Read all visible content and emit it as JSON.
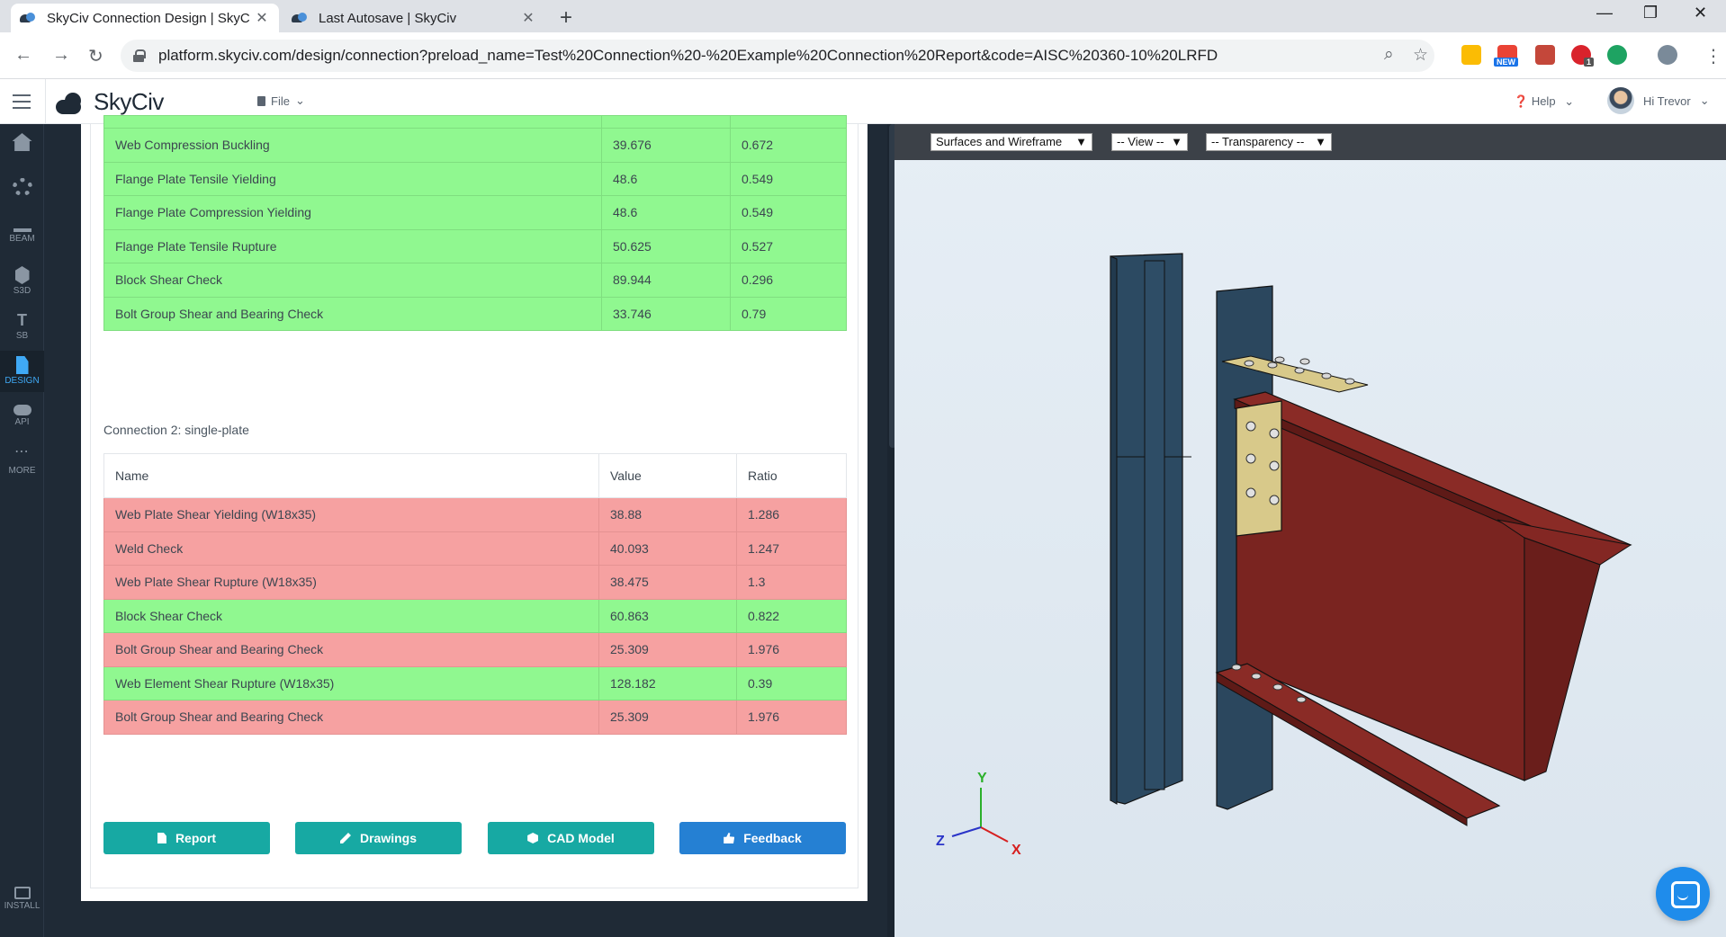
{
  "browser": {
    "tabs": [
      {
        "title": "SkyCiv Connection Design | SkyC",
        "active": true
      },
      {
        "title": "Last Autosave | SkyCiv",
        "active": false
      }
    ],
    "url": "platform.skyciv.com/design/connection?preload_name=Test%20Connection%20-%20Example%20Connection%20Report&code=AISC%20360-10%20LRFD",
    "extension_badge": "NEW",
    "abp_count": "1"
  },
  "app": {
    "logo_text": "SkyCiv",
    "file_menu": "File",
    "help_menu": "Help",
    "user_greeting": "Hi Trevor"
  },
  "sidebar": {
    "items": [
      {
        "label": "",
        "icon": "home-icon"
      },
      {
        "label": "",
        "icon": "gear-icon"
      },
      {
        "label": "BEAM",
        "icon": "beam-icon"
      },
      {
        "label": "S3D",
        "icon": "cube-icon"
      },
      {
        "label": "SB",
        "icon": "section-icon"
      },
      {
        "label": "DESIGN",
        "icon": "design-icon"
      },
      {
        "label": "API",
        "icon": "cloud-icon"
      },
      {
        "label": "MORE",
        "icon": "more-icon"
      },
      {
        "label": "INSTALL",
        "icon": "monitor-icon"
      }
    ]
  },
  "results": {
    "table1_rows": [
      {
        "name": "Web Compression Buckling",
        "value": "39.676",
        "ratio": "0.672",
        "status": "pass"
      },
      {
        "name": "Flange Plate Tensile Yielding",
        "value": "48.6",
        "ratio": "0.549",
        "status": "pass"
      },
      {
        "name": "Flange Plate Compression Yielding",
        "value": "48.6",
        "ratio": "0.549",
        "status": "pass"
      },
      {
        "name": "Flange Plate Tensile Rupture",
        "value": "50.625",
        "ratio": "0.527",
        "status": "pass"
      },
      {
        "name": "Block Shear Check",
        "value": "89.944",
        "ratio": "0.296",
        "status": "pass"
      },
      {
        "name": "Bolt Group Shear and Bearing Check",
        "value": "33.746",
        "ratio": "0.79",
        "status": "pass"
      }
    ],
    "connection2_label": "Connection 2: single-plate",
    "headers": {
      "name": "Name",
      "value": "Value",
      "ratio": "Ratio"
    },
    "table2_rows": [
      {
        "name": "Web Plate Shear Yielding (W18x35)",
        "value": "38.88",
        "ratio": "1.286",
        "status": "fail"
      },
      {
        "name": "Weld Check",
        "value": "40.093",
        "ratio": "1.247",
        "status": "fail"
      },
      {
        "name": "Web Plate Shear Rupture (W18x35)",
        "value": "38.475",
        "ratio": "1.3",
        "status": "fail"
      },
      {
        "name": "Block Shear Check",
        "value": "60.863",
        "ratio": "0.822",
        "status": "pass"
      },
      {
        "name": "Bolt Group Shear and Bearing Check",
        "value": "25.309",
        "ratio": "1.976",
        "status": "fail"
      },
      {
        "name": "Web Element Shear Rupture (W18x35)",
        "value": "128.182",
        "ratio": "0.39",
        "status": "pass"
      },
      {
        "name": "Bolt Group Shear and Bearing Check",
        "value": "25.309",
        "ratio": "1.976",
        "status": "fail"
      }
    ],
    "buttons": {
      "report": "Report",
      "drawings": "Drawings",
      "cad_model": "CAD Model",
      "feedback": "Feedback"
    }
  },
  "viewer": {
    "render_mode": "Surfaces and Wireframe",
    "view": "-- View --",
    "transparency": "-- Transparency --",
    "axes": {
      "x": "X",
      "y": "Y",
      "z": "Z"
    },
    "colors": {
      "column": "#2c4a62",
      "beam": "#7a2420",
      "plate": "#d8c98a"
    }
  },
  "colors": {
    "pass": "#90f890",
    "fail": "#f6a1a1",
    "teal_button": "#17a9a3",
    "blue_button": "#2580d3"
  }
}
